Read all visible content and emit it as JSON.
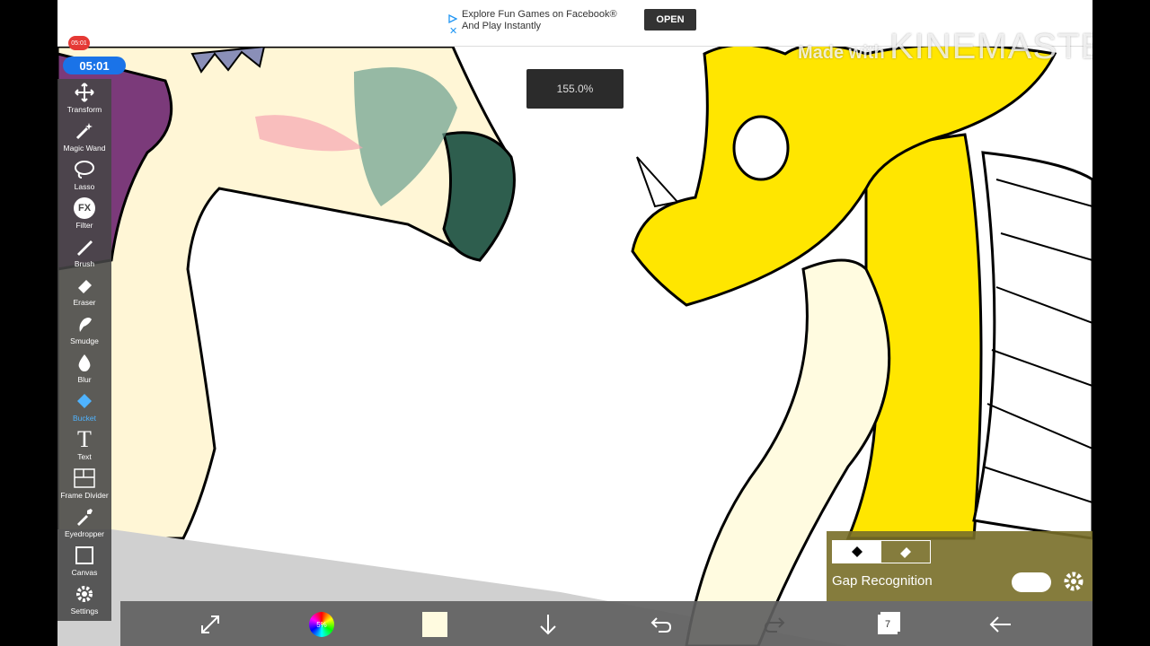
{
  "ad": {
    "line1": "Explore Fun Games on Facebook®",
    "line2": "And Play Instantly",
    "open_label": "OPEN"
  },
  "recording": {
    "badge": "05:01",
    "time": "05:01"
  },
  "zoom_level": "155.0%",
  "watermark": {
    "made_with": "Made with",
    "brand": "KINEMASTER"
  },
  "toolbar": {
    "tools": [
      {
        "label": "Transform",
        "icon": "transform-icon"
      },
      {
        "label": "Magic Wand",
        "icon": "magic-wand-icon"
      },
      {
        "label": "Lasso",
        "icon": "lasso-icon"
      },
      {
        "label": "Filter",
        "icon": "fx-icon",
        "icon_text": "FX"
      },
      {
        "label": "Brush",
        "icon": "brush-icon"
      },
      {
        "label": "Eraser",
        "icon": "eraser-icon"
      },
      {
        "label": "Smudge",
        "icon": "smudge-icon"
      },
      {
        "label": "Blur",
        "icon": "blur-icon"
      },
      {
        "label": "Bucket",
        "icon": "bucket-icon",
        "active": true
      },
      {
        "label": "Text",
        "icon": "text-icon",
        "icon_text": "T"
      },
      {
        "label": "Frame Divider",
        "icon": "frame-divider-icon"
      },
      {
        "label": "Eyedropper",
        "icon": "eyedropper-icon"
      },
      {
        "label": "Canvas",
        "icon": "canvas-icon"
      },
      {
        "label": "Settings",
        "icon": "gear-icon"
      }
    ]
  },
  "bottom_bar": {
    "color_wheel_text": "5%",
    "current_color": "#fffbe0",
    "layers_count": "7"
  },
  "gap_panel": {
    "label": "Gap Recognition"
  },
  "colors": {
    "accent": "#1a73e8",
    "active_tool": "#4fb3ff",
    "dragon_yellow": "#ffe600",
    "dragon_cream": "#fff6d6",
    "dragon_teal": "#3a8a70"
  }
}
